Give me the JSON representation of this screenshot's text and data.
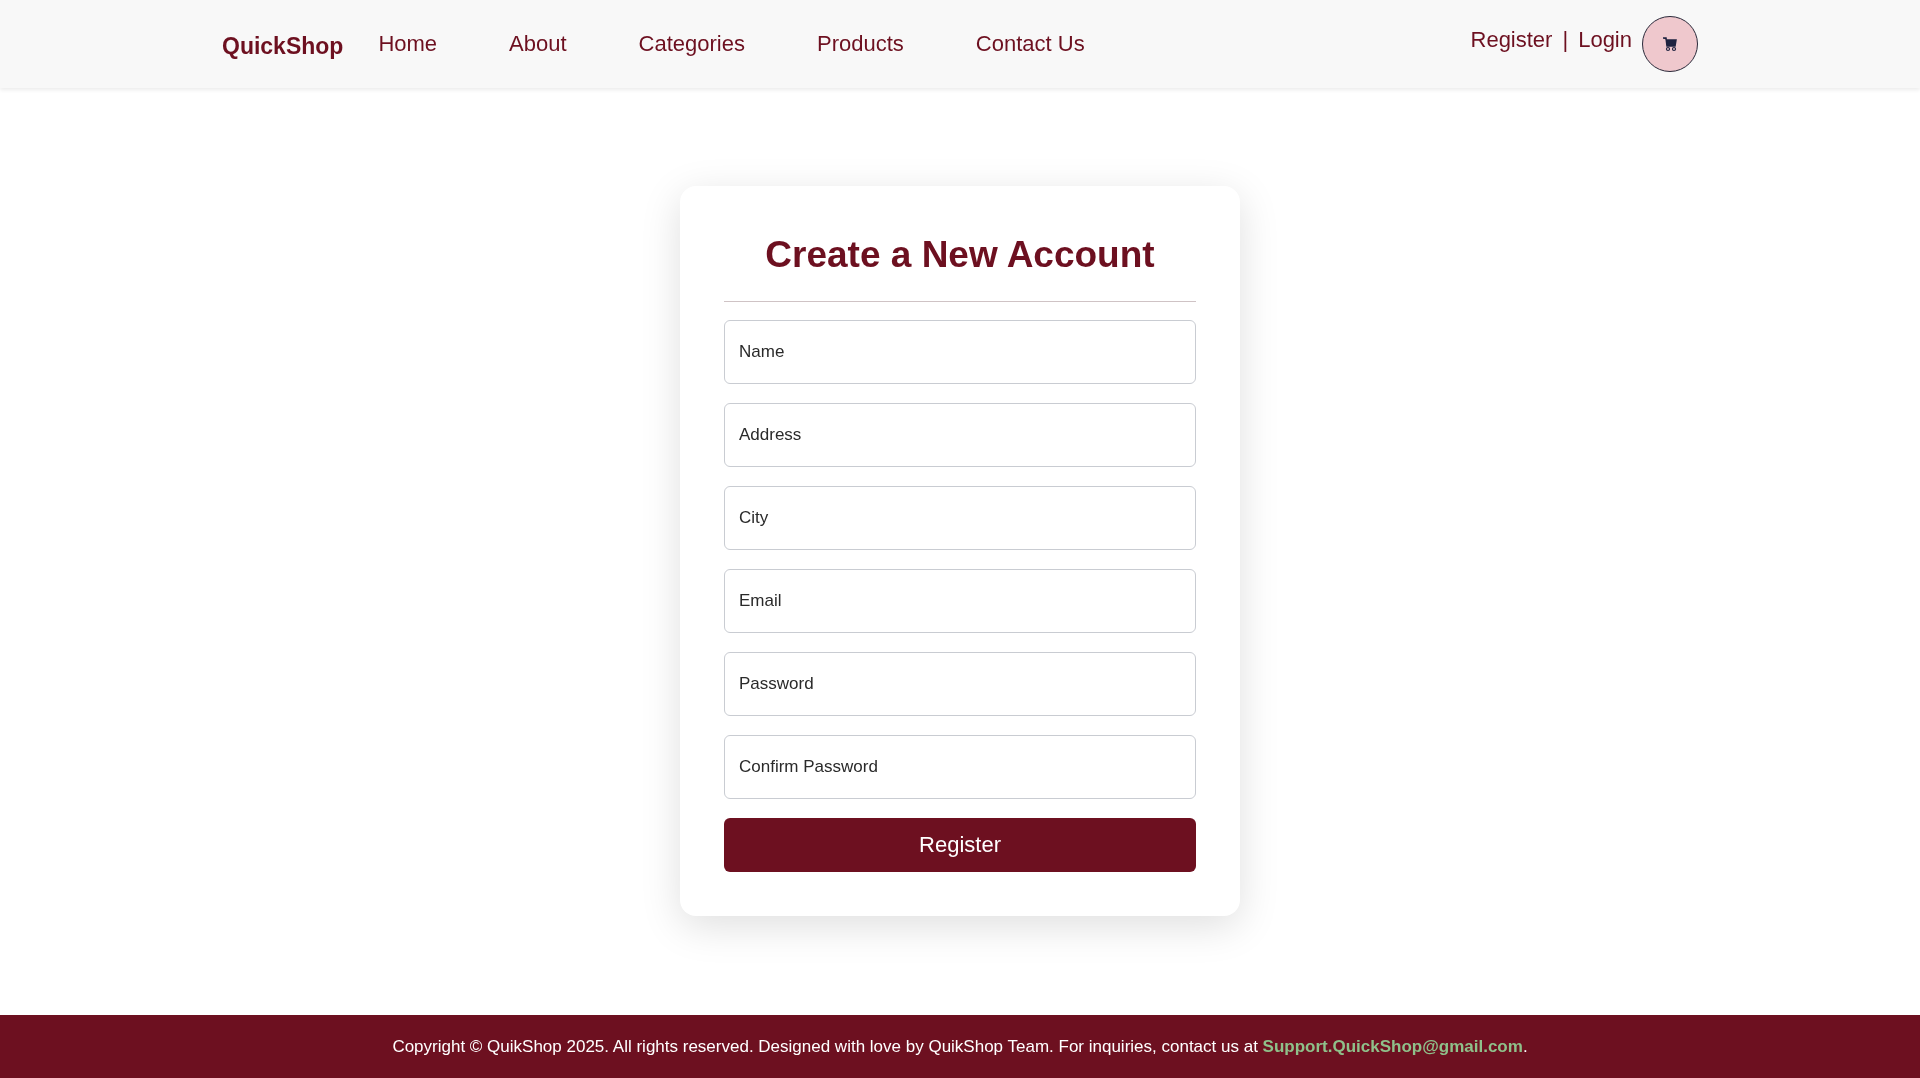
{
  "header": {
    "logo": "QuickShop",
    "nav": [
      {
        "label": "Home"
      },
      {
        "label": "About"
      },
      {
        "label": "Categories"
      },
      {
        "label": "Products"
      },
      {
        "label": "Contact Us"
      }
    ],
    "auth": {
      "register": "Register",
      "separator": "|",
      "login": "Login"
    }
  },
  "form": {
    "title": "Create a New Account",
    "fields": [
      {
        "placeholder": "Name"
      },
      {
        "placeholder": "Address"
      },
      {
        "placeholder": "City"
      },
      {
        "placeholder": "Email"
      },
      {
        "placeholder": "Password"
      },
      {
        "placeholder": "Confirm Password"
      }
    ],
    "button": "Register"
  },
  "footer": {
    "text": "Copyright © QuikShop 2025. All rights reserved. Designed with love by QuikShop Team. For inquiries, contact us at ",
    "email": "Support.QuickShop@gmail.com",
    "end": "."
  }
}
